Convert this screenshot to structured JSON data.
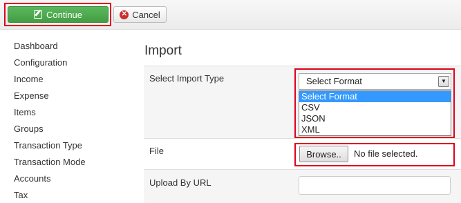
{
  "toolbar": {
    "continue_label": "Continue",
    "cancel_label": "Cancel",
    "icons": {
      "continue": "edit-icon",
      "cancel": "cancel-icon"
    },
    "colors": {
      "continue_bg": "#449d44",
      "highlight": "#e0001a"
    }
  },
  "sidebar": {
    "items": [
      {
        "label": "Dashboard"
      },
      {
        "label": "Configuration"
      },
      {
        "label": "Income"
      },
      {
        "label": "Expense"
      },
      {
        "label": "Items"
      },
      {
        "label": "Groups"
      },
      {
        "label": "Transaction Type"
      },
      {
        "label": "Transaction Mode"
      },
      {
        "label": "Accounts"
      },
      {
        "label": "Tax"
      }
    ]
  },
  "main": {
    "title": "Import",
    "import_type": {
      "label": "Select Import Type",
      "selected": "Select Format",
      "options": [
        "Select Format",
        "CSV",
        "JSON",
        "XML"
      ]
    },
    "file": {
      "label": "File",
      "browse_label": "Browse..",
      "status": "No file selected."
    },
    "url": {
      "label": "Upload By URL",
      "value": ""
    }
  }
}
